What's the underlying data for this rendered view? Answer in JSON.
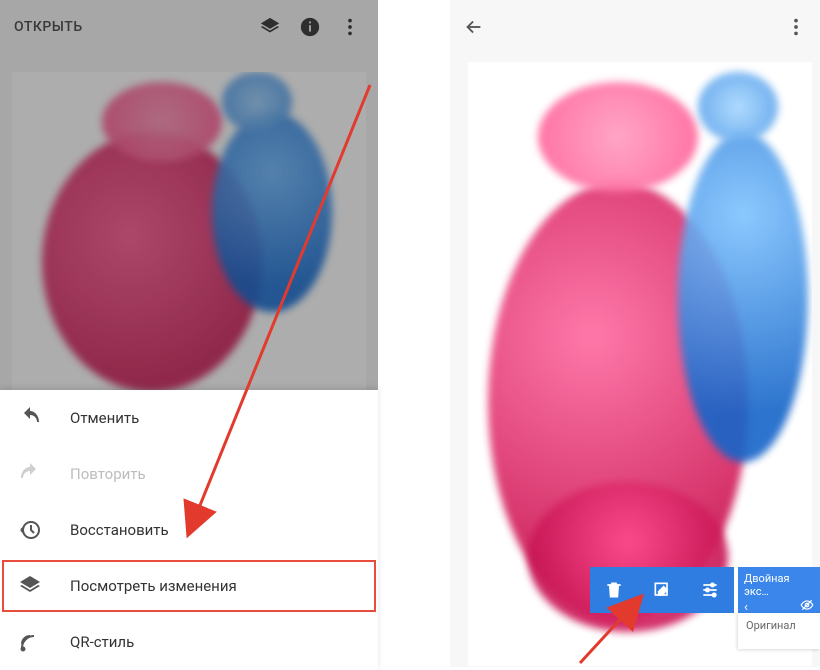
{
  "left": {
    "open_label": "ОТКРЫТЬ",
    "menu": [
      {
        "icon": "undo",
        "label": "Отменить",
        "enabled": true,
        "selected": false
      },
      {
        "icon": "redo",
        "label": "Повторить",
        "enabled": false,
        "selected": false
      },
      {
        "icon": "history",
        "label": "Восстановить",
        "enabled": true,
        "selected": false
      },
      {
        "icon": "layers",
        "label": "Посмотреть изменения",
        "enabled": true,
        "selected": true
      },
      {
        "icon": "qr",
        "label": "QR-стиль",
        "enabled": true,
        "selected": false
      }
    ]
  },
  "right": {
    "filter_name": "Двойная экс…",
    "filter_back": "‹",
    "original_label": "Оригинал"
  },
  "colors": {
    "accent": "#2f7de1",
    "highlight": "#e74c3c"
  }
}
